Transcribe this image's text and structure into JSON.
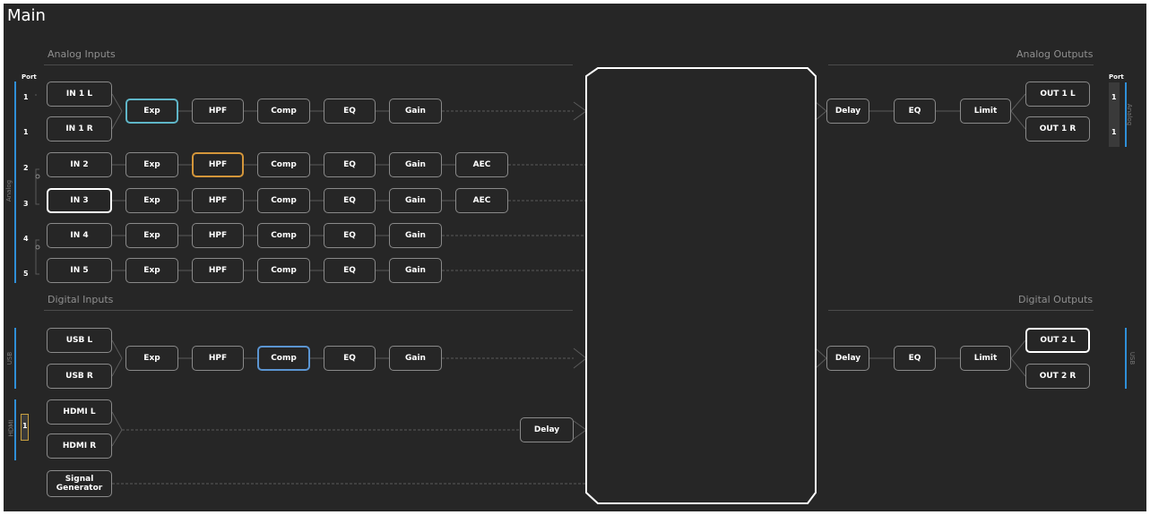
{
  "page": {
    "title": "Main"
  },
  "sections": {
    "analog_inputs": "Analog Inputs",
    "digital_inputs": "Digital Inputs",
    "analog_outputs": "Analog Outputs",
    "digital_outputs": "Digital Outputs"
  },
  "side": {
    "port": "Port",
    "analog": "Analog",
    "usb": "USB",
    "hdmi": "HDMI",
    "in_ports": [
      "1",
      "1",
      "2",
      "3",
      "4",
      "5"
    ],
    "hdmi_port": "1",
    "out_ports": [
      "1",
      "1"
    ]
  },
  "inputs": [
    "IN 1 L",
    "IN 1 R",
    "IN 2",
    "IN 3",
    "IN 4",
    "IN 5",
    "USB L",
    "USB R",
    "HDMI L",
    "HDMI R",
    "Signal Generator"
  ],
  "chain": {
    "exp": "Exp",
    "hpf": "HPF",
    "comp": "Comp",
    "eq": "EQ",
    "gain": "Gain",
    "aec": "AEC",
    "delay": "Delay",
    "limit": "Limit"
  },
  "outputs": [
    "OUT 1 L",
    "OUT 1 R",
    "OUT 2 L",
    "OUT 2 R"
  ],
  "colors": {
    "background": "#262626",
    "selected": "#ffffff",
    "exp_active": "#5fb6c8",
    "hpf_active": "#d4963a",
    "comp_active": "#5b95d2",
    "port_bar": "#2f8fd8",
    "hdmi_port": "#c8a040"
  }
}
